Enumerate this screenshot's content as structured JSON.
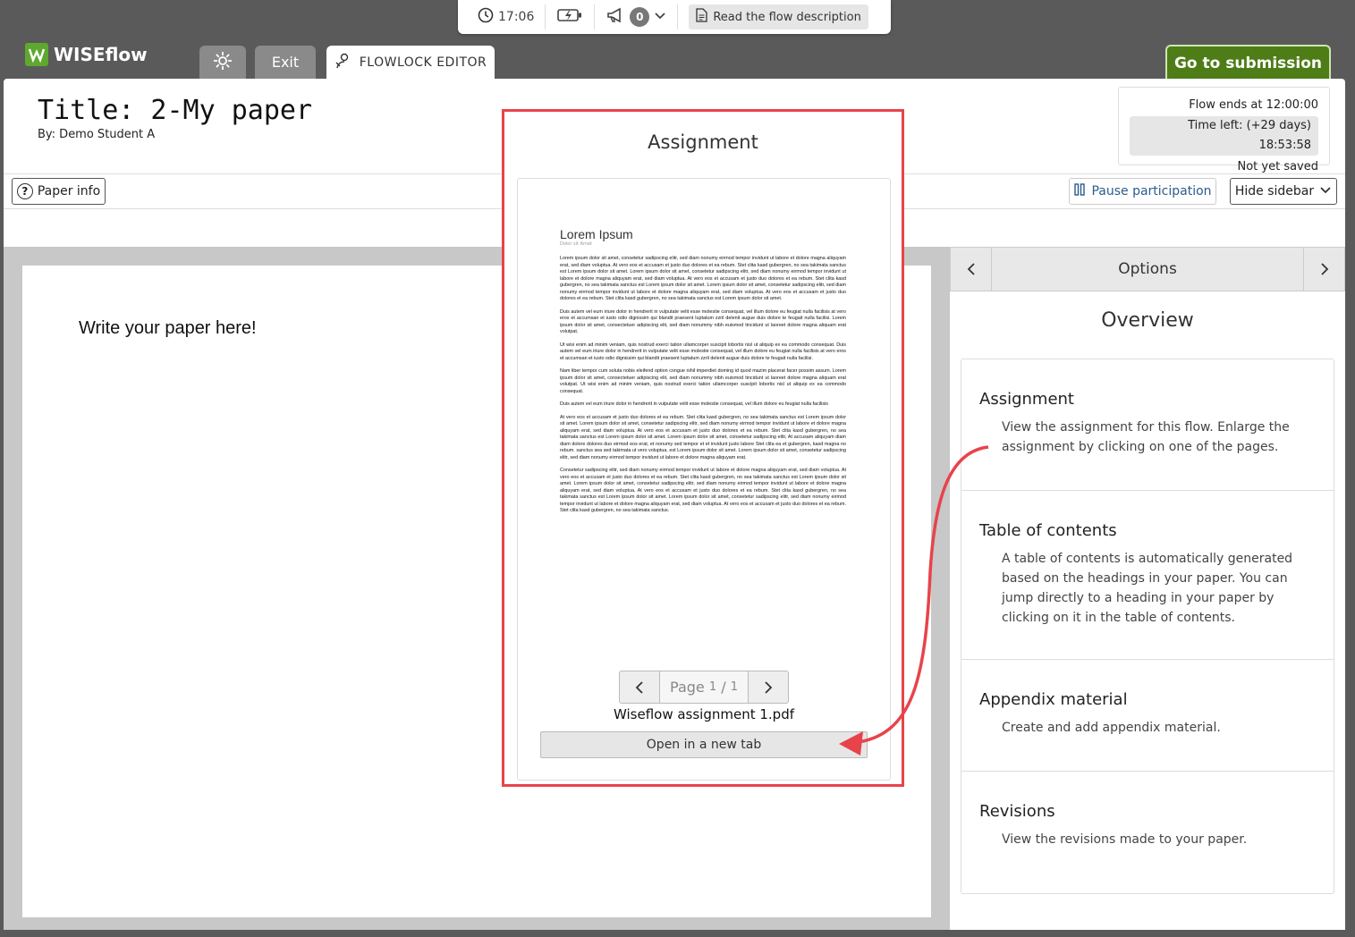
{
  "statusbar": {
    "clock_time": "17:06",
    "notification_count": "0",
    "read_description": "Read the flow description"
  },
  "header": {
    "brand": "WISEflow",
    "exit_label": "Exit",
    "editor_tab_label": "FLOWLOCK EDITOR",
    "goto_submission": "Go to submission"
  },
  "paper": {
    "title": "Title: 2-My paper",
    "by": "By: Demo Student A",
    "editor_text": "Write your paper here!"
  },
  "flow": {
    "ends": "Flow ends at 12:00:00",
    "time_left_label": "Time left:",
    "time_left_days": "(+29 days)",
    "time_left_clock": "18:53:58",
    "save_status": "Not yet saved"
  },
  "toolbar": {
    "paper_info": "Paper info",
    "pause": "Pause participation",
    "hide_sidebar": "Hide sidebar"
  },
  "assignment": {
    "title": "Assignment",
    "pdf_heading": "Lorem Ipsum",
    "pdf_subheading": "Dolor sit Amet",
    "pdf_paragraphs": [
      "Lorem ipsum dolor sit amet, consetetur sadipscing elitr, sed diam nonumy eirmod tempor invidunt ut labore et dolore magna aliquyam erat, sed diam voluptua. At vero eos et accusam et justo duo dolores et ea rebum. Stet clita kasd gubergren, no sea takimata sanctus est Lorem ipsum dolor sit amet. Lorem ipsum dolor sit amet, consetetur sadipscing elitr, sed diam nonumy eirmod tempor invidunt ut labore et dolore magna aliquyam erat, sed diam voluptua. At vero eos et accusam et justo duo dolores et ea rebum. Stet clita kasd gubergren, no sea takimata sanctus est Lorem ipsum dolor sit amet. Lorem ipsum dolor sit amet, consetetur sadipscing elitr, sed diam nonumy eirmod tempor invidunt ut labore et dolore magna aliquyam erat, sed diam voluptua. At vero eos et accusam et justo duo dolores et ea rebum. Stet clita kasd gubergren, no sea takimata sanctus est Lorem ipsum dolor sit amet.",
      "Duis autem vel eum iriure dolor in hendrerit in vulputate velit esse molestie consequat, vel illum dolore eu feugiat nulla facilisis at vero eros et accumsan et iusto odio dignissim qui blandit praesent luptatum zzril delenit augue duis dolore te feugait nulla facilisi. Lorem ipsum dolor sit amet, consectetuer adipiscing elit, sed diam nonummy nibh euismod tincidunt ut laoreet dolore magna aliquam erat volutpat.",
      "Ut wisi enim ad minim veniam, quis nostrud exerci tation ullamcorper suscipit lobortis nisl ut aliquip ex ea commodo consequat. Duis autem vel eum iriure dolor in hendrerit in vulputate velit esse molestie consequat, vel illum dolore eu feugiat nulla facilisis at vero eros et accumsan et iusto odio dignissim qui blandit praesent luptatum zzril delenit augue duis dolore te feugait nulla facilisi.",
      "Nam liber tempor cum soluta nobis eleifend option congue nihil imperdiet doming id quod mazim placerat facer possim assum. Lorem ipsum dolor sit amet, consectetuer adipiscing elit, sed diam nonummy nibh euismod tincidunt ut laoreet dolore magna aliquam erat volutpat. Ut wisi enim ad minim veniam, quis nostrud exerci tation ullamcorper suscipit lobortis nisl ut aliquip ex ea commodo consequat.",
      "Duis autem vel eum iriure dolor in hendrerit in vulputate velit esse molestie consequat, vel illum dolore eu feugiat nulla facilisis",
      "At vero eos et accusam et justo duo dolores et ea rebum. Stet clita kasd gubergren, no sea takimata sanctus est Lorem ipsum dolor sit amet. Lorem ipsum dolor sit amet, consetetur sadipscing elitr, sed diam nonumy eirmod tempor invidunt ut labore et dolore magna aliquyam erat, sed diam voluptua. At vero eos et accusam et justo duo dolores et ea rebum. Stet clita kasd gubergren, no sea takimata sanctus est Lorem ipsum dolor sit amet. Lorem ipsum dolor sit amet, consetetur sadipscing elitr, At accusam aliquyam diam diam dolore dolores duo eirmod eos erat, et nonumy sed tempor et et invidunt justo labore Stet clita ea et gubergren, kasd magna no rebum. sanctus sea sed takimata ut vero voluptua. est Lorem ipsum dolor sit amet. Lorem ipsum dolor sit amet, consetetur sadipscing elitr, sed diam nonumy eirmod tempor invidunt ut labore et dolore magna aliquyam erat.",
      "Consetetur sadipscing elitr, sed diam nonumy eirmod tempor invidunt ut labore et dolore magna aliquyam erat, sed diam voluptua. At vero eos et accusam et justo duo dolores et ea rebum. Stet clita kasd gubergren, no sea takimata sanctus est Lorem ipsum dolor sit amet. Lorem ipsum dolor sit amet, consetetur sadipscing elitr, sed diam nonumy eirmod tempor invidunt ut labore et dolore magna aliquyam erat, sed diam voluptua. At vero eos et accusam et justo duo dolores et ea rebum. Stet clita kasd gubergren, no sea takimata sanctus est Lorem ipsum dolor sit amet. Lorem ipsum dolor sit amet, consetetur sadipscing elitr, sed diam nonumy eirmod tempor invidunt ut labore et dolore magna aliquyam erat, sed diam voluptua. At vero eos et accusam et justo duo dolores et ea rebum. Stet clita kasd gubergren, no sea takimata sanctus."
    ],
    "page_label": "Page",
    "page_current": "1",
    "page_total": "1",
    "filename": "Wiseflow assignment 1.pdf",
    "open_new_tab": "Open in a new tab"
  },
  "sidebar": {
    "options_title": "Options",
    "overview_title": "Overview",
    "items": [
      {
        "title": "Assignment",
        "desc": "View the assignment for this flow. Enlarge the assignment by clicking on one of the pages."
      },
      {
        "title": "Table of contents",
        "desc": "A table of contents is automatically generated based on the headings in your paper. You can jump directly to a heading in your paper by clicking on it in the table of contents."
      },
      {
        "title": "Appendix material",
        "desc": "Create and add appendix material."
      },
      {
        "title": "Revisions",
        "desc": "View the revisions made to your paper."
      }
    ]
  },
  "colors": {
    "highlight_red": "#e8434b",
    "submit_green": "#4e7d18",
    "brand_green": "#5fa830"
  }
}
